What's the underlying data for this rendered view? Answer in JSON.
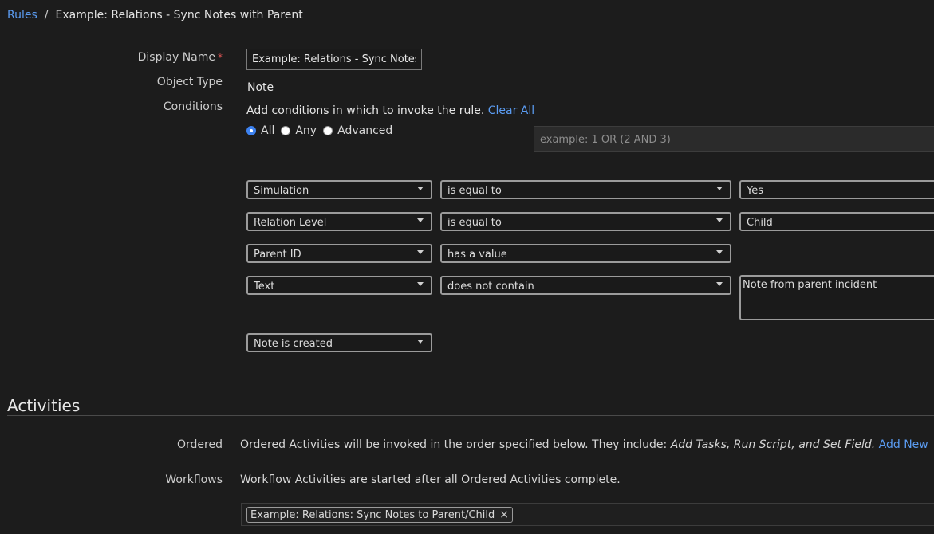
{
  "breadcrumb": {
    "root": "Rules",
    "separator": "/",
    "current": "Example: Relations - Sync Notes with Parent"
  },
  "form": {
    "display_name_label": "Display Name",
    "required_mark": "*",
    "display_name_value": "Example: Relations - Sync Notes",
    "object_type_label": "Object Type",
    "object_type_value": "Note",
    "conditions_label": "Conditions",
    "conditions_help": "Add conditions in which to invoke the rule.",
    "clear_all": "Clear All",
    "match_options": [
      "All",
      "Any",
      "Advanced"
    ],
    "match_selected": "All",
    "advanced_placeholder": "example: 1 OR (2 AND 3)"
  },
  "conditions": [
    {
      "field": "Simulation",
      "operator": "is equal to",
      "value": "Yes"
    },
    {
      "field": "Relation Level",
      "operator": "is equal to",
      "value": "Child"
    },
    {
      "field": "Parent ID",
      "operator": "has a value",
      "value": ""
    },
    {
      "field": "Text",
      "operator": "does not contain",
      "value": "Note from parent incident"
    }
  ],
  "trigger": {
    "event": "Note is created"
  },
  "activities": {
    "title": "Activities",
    "ordered_label": "Ordered",
    "ordered_text": "Ordered Activities will be invoked in the order specified below. They include:",
    "ordered_list": "Add Tasks, Run Script, and Set Field.",
    "add_new": "Add New",
    "workflows_label": "Workflows",
    "workflows_text": "Workflow Activities are started after all Ordered Activities complete.",
    "workflow_chip": "Example: Relations: Sync Notes to Parent/Child",
    "chip_remove": "×"
  }
}
